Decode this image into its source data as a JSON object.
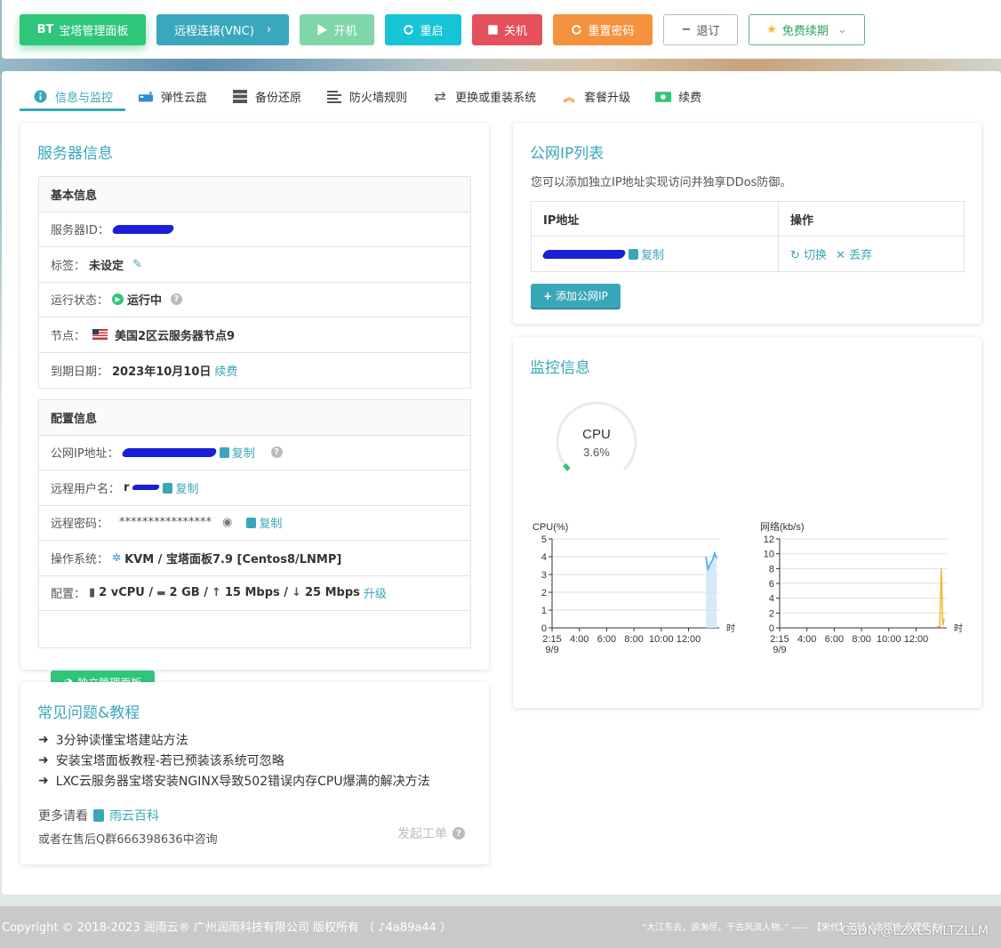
{
  "toolbar": {
    "bt_panel": "宝塔管理面板",
    "bt_logo": "BT",
    "vnc": "远程连接(VNC)",
    "start": "开机",
    "restart": "重启",
    "shutdown": "关机",
    "reset_password": "重置密码",
    "refund": "退订",
    "free_renew": "免费续期"
  },
  "tabs": [
    {
      "label": "信息与监控",
      "icon": "info-icon",
      "active": true
    },
    {
      "label": "弹性云盘",
      "icon": "disk-icon"
    },
    {
      "label": "备份还原",
      "icon": "backup-icon"
    },
    {
      "label": "防火墙规则",
      "icon": "list-icon"
    },
    {
      "label": "更换或重装系统",
      "icon": "exchange-icon"
    },
    {
      "label": "套餐升级",
      "icon": "upgrade-icon"
    },
    {
      "label": "续费",
      "icon": "money-icon"
    }
  ],
  "server_info": {
    "title": "服务器信息",
    "basic_header": "基本信息",
    "server_id_label": "服务器ID：",
    "tag_label": "标签：",
    "tag_value": "未设定",
    "status_label": "运行状态：",
    "status_value": "运行中",
    "node_label": "节点：",
    "node_value": "美国2区云服务器节点9",
    "expiry_label": "到期日期：",
    "expiry_value": "2023年10月10日",
    "renew_link": "续费",
    "config_header": "配置信息",
    "public_ip_label": "公网IP地址：",
    "copy": "复制",
    "remote_user_label": "远程用户名：",
    "remote_user_value": "r",
    "remote_pwd_label": "远程密码：",
    "remote_pwd_value": "****************",
    "os_label": "操作系统：",
    "os_value": "KVM / 宝塔面板7.9 [Centos8/LNMP]",
    "config_label": "配置：",
    "config_value": "2 vCPU / ",
    "config_ram": "2 GB / ",
    "config_up": "15 Mbps / ",
    "config_down": "25 Mbps",
    "upgrade_link": "升级",
    "panel_button": "独立管理面板"
  },
  "public_ip": {
    "title": "公网IP列表",
    "desc": "您可以添加独立IP地址实现访问并独享DDos防御。",
    "col_ip": "IP地址",
    "col_action": "操作",
    "copy": "复制",
    "switch": "切换",
    "discard": "丢弃",
    "add_button": "添加公网IP"
  },
  "monitor": {
    "title": "监控信息",
    "gauge_label": "CPU",
    "gauge_value": "3.6%",
    "gauge_percent": 3.6
  },
  "faq": {
    "title": "常见问题&教程",
    "items": [
      "3分钟读懂宝塔建站方法",
      "安装宝塔面板教程-若已预装该系统可忽略",
      "LXC云服务器宝塔安装NGINX导致502错误内存CPU爆满的解决方法"
    ],
    "more_label": "更多请看",
    "more_link": "雨云百科",
    "qq_group": "或者在售后Q群666398636中咨询",
    "ticket": "发起工单"
  },
  "footer": {
    "copyright": "Copyright © 2018-2023 润雨云® 广州润雨科技有限公司 版权所有 （ ♪4a89a44 ）",
    "quote": "“大江东去，浪淘尽，千古风流人物。” —— 【宋代】苏轼《念奴娇·赤壁怀古》"
  },
  "watermark": "CSDN @LZXLSMLTZLLM",
  "colors": {
    "accent": "#3aa7b9",
    "green": "#2fc67a",
    "red": "#e5505d",
    "orange": "#f5923e",
    "cpu_line": "#39a7f0",
    "net_line": "#f5b82e"
  },
  "chart_data": [
    {
      "type": "area",
      "title": "CPU(%)",
      "xlabel": "时",
      "ylabel": "CPU(%)",
      "x_ticks": [
        "2:15\n9/9",
        "4:00",
        "6:00",
        "8:00",
        "10:00",
        "12:00"
      ],
      "y_ticks": [
        "0",
        "1",
        "2",
        "3",
        "4",
        "5"
      ],
      "ylim": [
        0,
        5
      ],
      "series": [
        {
          "values": [
            4.0,
            3.3,
            3.6,
            3.8,
            4.2,
            3.9
          ]
        }
      ],
      "series_x_fraction": [
        0.0,
        0.2,
        0.4,
        0.6,
        0.8,
        1.0
      ],
      "series_span": [
        0.935,
        1.0
      ]
    },
    {
      "type": "line",
      "title": "网络(kb/s)",
      "xlabel": "时",
      "ylabel": "网络(kb/s)",
      "x_ticks": [
        "2:15\n9/9",
        "4:00",
        "6:00",
        "8:00",
        "10:00",
        "12:00"
      ],
      "y_ticks": [
        "0",
        "2",
        "4",
        "6",
        "8",
        "10",
        "12"
      ],
      "ylim": [
        0,
        12
      ],
      "series": [
        {
          "values": [
            0.1,
            0.2,
            8.0,
            0.3,
            1.2
          ]
        }
      ],
      "series_x_fraction": [
        0.0,
        0.4,
        0.6,
        0.8,
        1.0
      ],
      "series_span": [
        0.955,
        1.0
      ]
    }
  ]
}
